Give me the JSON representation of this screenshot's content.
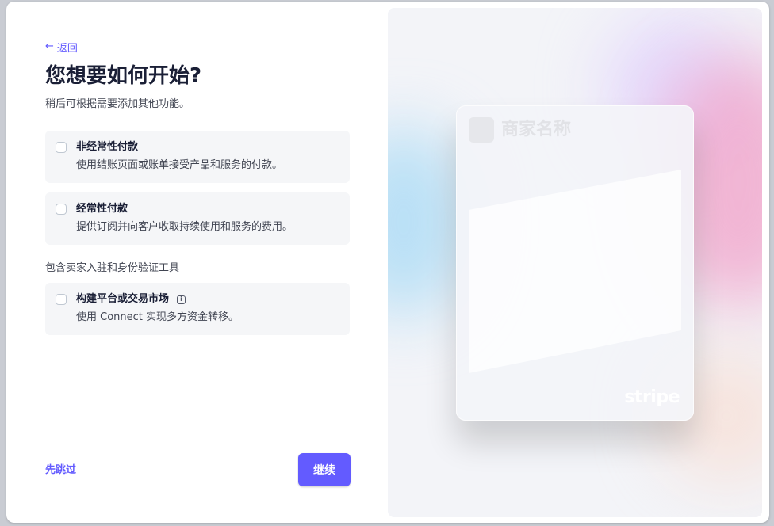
{
  "nav": {
    "back_icon": "arrow-left-icon",
    "back_label": "返回"
  },
  "header": {
    "title": "您想要如何开始?",
    "subtitle": "稍后可根据需要添加其他功能。"
  },
  "options": [
    {
      "title": "非经常性付款",
      "description": "使用结账页面或账单接受产品和服务的付款。",
      "checked": false
    },
    {
      "title": "经常性付款",
      "description": "提供订阅并向客户收取持续使用和服务的费用。",
      "checked": false
    }
  ],
  "platform_section": {
    "label": "包含卖家入驻和身份验证工具",
    "option": {
      "title": "构建平台或交易市场",
      "info_icon": "info-icon",
      "description": "使用 Connect 实现多方资金转移。",
      "checked": false
    }
  },
  "footer": {
    "skip_label": "先跳过",
    "continue_label": "继续"
  },
  "preview": {
    "merchant_name": "商家名称",
    "brand": "stripe"
  },
  "colors": {
    "accent": "#635bff",
    "option_bg": "#f5f6f8",
    "title_text": "#1a1f36",
    "body_text": "#414552"
  }
}
